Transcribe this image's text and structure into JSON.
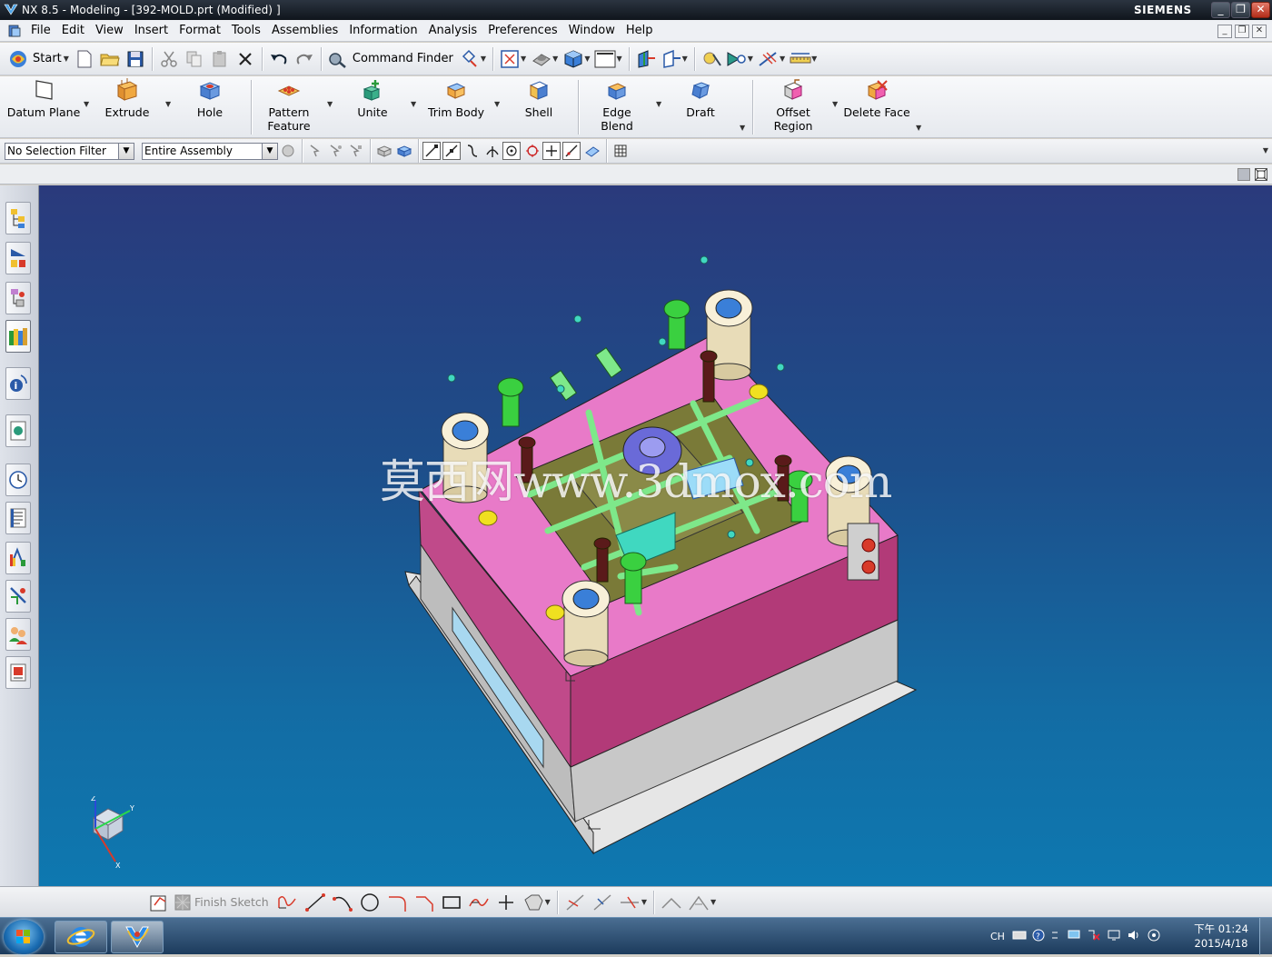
{
  "window": {
    "title": "NX 8.5 - Modeling - [392-MOLD.prt (Modified) ]",
    "brand": "SIEMENS",
    "controls": {
      "minimize": "_",
      "restore": "❐",
      "close": "✕"
    }
  },
  "menu": {
    "items": [
      "File",
      "Edit",
      "View",
      "Insert",
      "Format",
      "Tools",
      "Assemblies",
      "Information",
      "Analysis",
      "Preferences",
      "Window",
      "Help"
    ]
  },
  "standard_toolbar": {
    "start_label": "Start",
    "command_finder_label": "Command Finder"
  },
  "feature_ribbon": {
    "datum_plane": "Datum Plane",
    "extrude": "Extrude",
    "hole": "Hole",
    "pattern_feature_line1": "Pattern",
    "pattern_feature_line2": "Feature",
    "unite": "Unite",
    "trim_body": "Trim Body",
    "shell": "Shell",
    "edge_blend": "Edge Blend",
    "draft": "Draft",
    "offset_region_line1": "Offset",
    "offset_region_line2": "Region",
    "delete_face": "Delete Face"
  },
  "selection_bar": {
    "filter_value": "No Selection Filter",
    "scope_value": "Entire Assembly"
  },
  "sketch_bar": {
    "finish_sketch_label": "Finish Sketch"
  },
  "graphics": {
    "watermark": "莫西网www.3dmox.com",
    "triad_labels": {
      "z": "Z",
      "y": "Y",
      "x": "X"
    }
  },
  "taskbar": {
    "tray_lang": "CH",
    "clock_time": "下午 01:24",
    "clock_date": "2015/4/18"
  },
  "colors": {
    "viewport_top": "#2a3a7c",
    "viewport_bottom": "#0e78b0",
    "mold_plate_pink": "#e87ac8",
    "mold_plate_side": "#c04a8a",
    "cooling_lines": "#7ee88a",
    "cavity_olive": "#7a7a38"
  }
}
